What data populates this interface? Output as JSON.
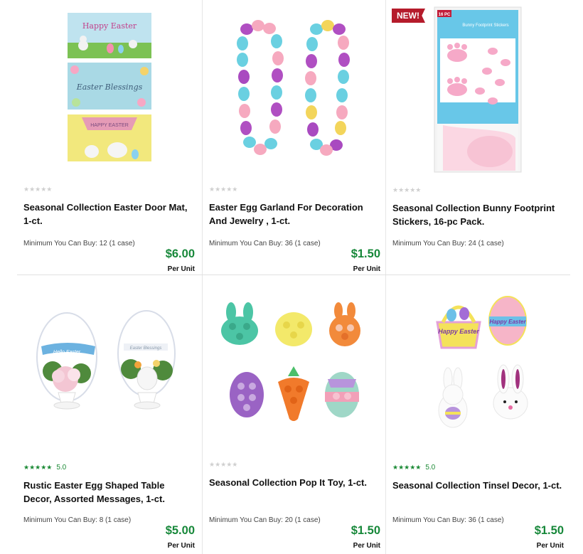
{
  "products": [
    {
      "title": "Seasonal Collection Easter Door Mat, 1-ct.",
      "min_label": "Minimum You Can Buy: 12 (1 case)",
      "price": "$6.00",
      "unit": "Per Unit",
      "rating": null
    },
    {
      "title": "Easter Egg Garland For Decoration And Jewelry , 1-ct.",
      "min_label": "Minimum You Can Buy: 36 (1 case)",
      "price": "$1.50",
      "unit": "Per Unit",
      "rating": null
    },
    {
      "title": "Seasonal Collection Bunny Footprint Stickers, 16-pc Pack.",
      "min_label": "Minimum You Can Buy: 24 (1 case)",
      "price": null,
      "unit": null,
      "rating": null,
      "badge": "NEW!",
      "pack_label": "16 PC",
      "package_title": "Bunny Footprint Stickers"
    },
    {
      "title": "Rustic Easter Egg Shaped Table Decor, Assorted Messages, 1-ct.",
      "min_label": "Minimum You Can Buy: 8 (1 case)",
      "price": "$5.00",
      "unit": "Per Unit",
      "rating": "5.0",
      "sign_text": "Hello Easter",
      "sign_text_2": "Easter Blessings"
    },
    {
      "title": "Seasonal Collection Pop It Toy, 1-ct.",
      "min_label": "Minimum You Can Buy: 20 (1 case)",
      "price": "$1.50",
      "unit": "Per Unit",
      "rating": null
    },
    {
      "title": "Seasonal Collection Tinsel Decor, 1-ct.",
      "min_label": "Minimum You Can Buy: 36 (1 case)",
      "price": "$1.50",
      "unit": "Per Unit",
      "rating": "5.0",
      "tinsel_text_1": "Happy Easter",
      "tinsel_text_2": "Happy Easter"
    }
  ],
  "mat_texts": [
    "Happy Easter",
    "Easter Blessings",
    "HAPPY EASTER"
  ],
  "stars_glyph": "★★★★★",
  "colors": {
    "price": "#17883a",
    "rating": "#1b8a35",
    "badge": "#b51b2b"
  }
}
